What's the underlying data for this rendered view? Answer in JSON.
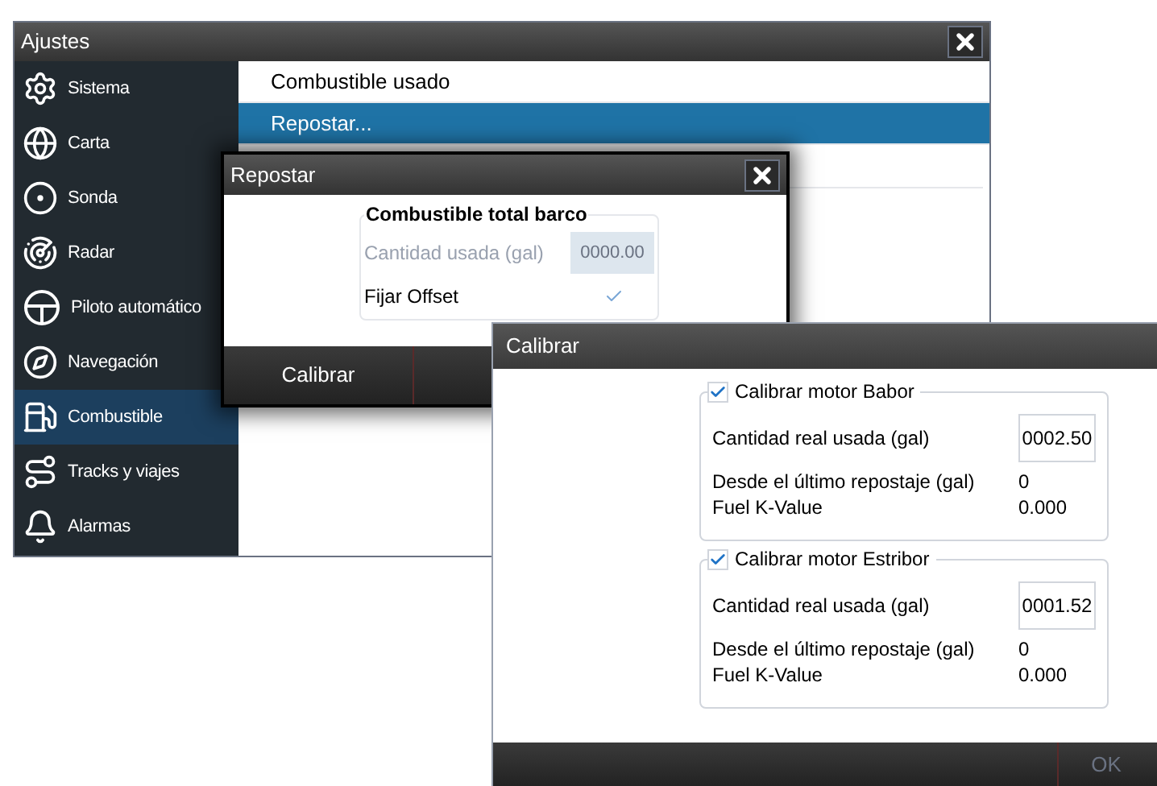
{
  "settings_window": {
    "title": "Ajustes",
    "sidebar": {
      "items": [
        {
          "label": "Sistema",
          "selected": false
        },
        {
          "label": "Carta",
          "selected": false
        },
        {
          "label": "Sonda",
          "selected": false
        },
        {
          "label": "Radar",
          "selected": false
        },
        {
          "label": "Piloto automático",
          "selected": false
        },
        {
          "label": "Navegación",
          "selected": false
        },
        {
          "label": "Combustible",
          "selected": true
        },
        {
          "label": "Tracks y viajes",
          "selected": false
        },
        {
          "label": "Alarmas",
          "selected": false
        }
      ]
    },
    "content": {
      "items": [
        {
          "label": "Combustible usado",
          "selected": false
        },
        {
          "label": "Repostar...",
          "selected": true
        }
      ]
    }
  },
  "refuel_dialog": {
    "title": "Repostar",
    "group": {
      "legend": "Combustible total barco",
      "rows": [
        {
          "kind": "field",
          "label": "Cantidad usada (gal)",
          "value": "0000.00",
          "disabled": true
        },
        {
          "kind": "checkbox",
          "label": "Fijar Offset",
          "checked": true
        }
      ]
    },
    "buttons": [
      {
        "label": "Calibrar",
        "disabled": false
      }
    ]
  },
  "calibrate_dialog": {
    "title": "Calibrar",
    "groups": [
      {
        "legend": "Calibrar motor Babor",
        "checked": true,
        "rows": [
          {
            "kind": "field",
            "label": "Cantidad real usada (gal)",
            "value": "0002.50"
          },
          {
            "kind": "value",
            "label": "Desde el último repostaje (gal)",
            "value": "0"
          },
          {
            "kind": "value",
            "label": "Fuel K-Value",
            "value": "0.000"
          }
        ]
      },
      {
        "legend": "Calibrar motor Estribor",
        "checked": true,
        "rows": [
          {
            "kind": "field",
            "label": "Cantidad real usada (gal)",
            "value": "0001.52"
          },
          {
            "kind": "value",
            "label": "Desde el último repostaje (gal)",
            "value": "0"
          },
          {
            "kind": "value",
            "label": "Fuel K-Value",
            "value": "0.000"
          }
        ]
      }
    ],
    "buttons": [
      {
        "label": "OK",
        "disabled": true
      }
    ]
  }
}
